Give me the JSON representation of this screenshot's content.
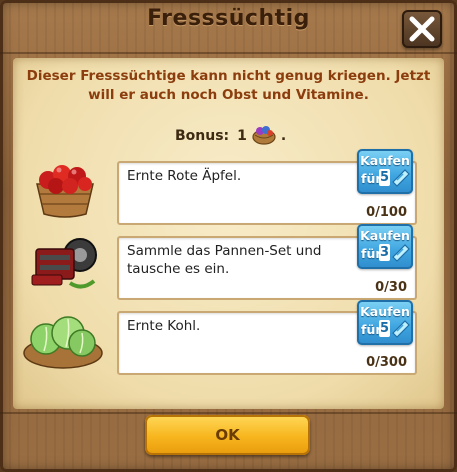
{
  "dialog": {
    "title": "Fresssüchtig",
    "intro": "Dieser Fresssüchtige kann nicht genug kriegen. Jetzt will er auch noch Obst und Vitamine.",
    "bonus_label": "Bonus:",
    "bonus_value": "1",
    "bonus_suffix": ".",
    "ok_label": "OK"
  },
  "tasks": [
    {
      "icon": "apple-basket-icon",
      "text": "Ernte Rote Äpfel.",
      "progress": "0/100",
      "buy_label": "Kaufen",
      "buy_prefix": "für",
      "buy_cost": "5"
    },
    {
      "icon": "repair-kit-icon",
      "text": "Sammle das Pannen-Set und tausche es ein.",
      "progress": "0/30",
      "buy_label": "Kaufen",
      "buy_prefix": "für",
      "buy_cost": "3"
    },
    {
      "icon": "cabbage-icon",
      "text": "Ernte Kohl.",
      "progress": "0/300",
      "buy_label": "Kaufen",
      "buy_prefix": "für",
      "buy_cost": "5"
    }
  ],
  "colors": {
    "intro_text": "#8c3d0e",
    "buy_button": "#3ea4e0",
    "ok_button": "#f7b51d"
  }
}
